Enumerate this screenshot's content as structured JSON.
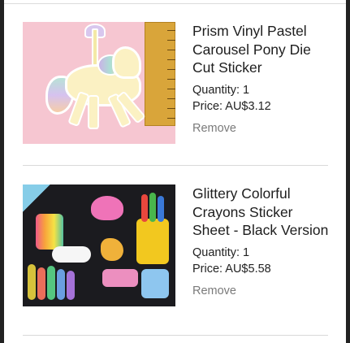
{
  "cart": {
    "items": [
      {
        "title": "Prism Vinyl Pastel Carousel Pony Die Cut Sticker",
        "quantity_text": "Quantity: 1",
        "price_text": "Price: AU$3.12",
        "remove_label": "Remove",
        "image_icon": "carousel-pony-sticker-photo"
      },
      {
        "title": "Glittery Colorful Crayons Sticker Sheet - Black Version",
        "quantity_text": "Quantity: 1",
        "price_text": "Price: AU$5.58",
        "remove_label": "Remove",
        "image_icon": "crayons-sticker-sheet-photo"
      }
    ]
  },
  "colors": {
    "background": "#ffffff",
    "divider": "#d9d9d9",
    "remove_text": "#7a7a7a"
  }
}
